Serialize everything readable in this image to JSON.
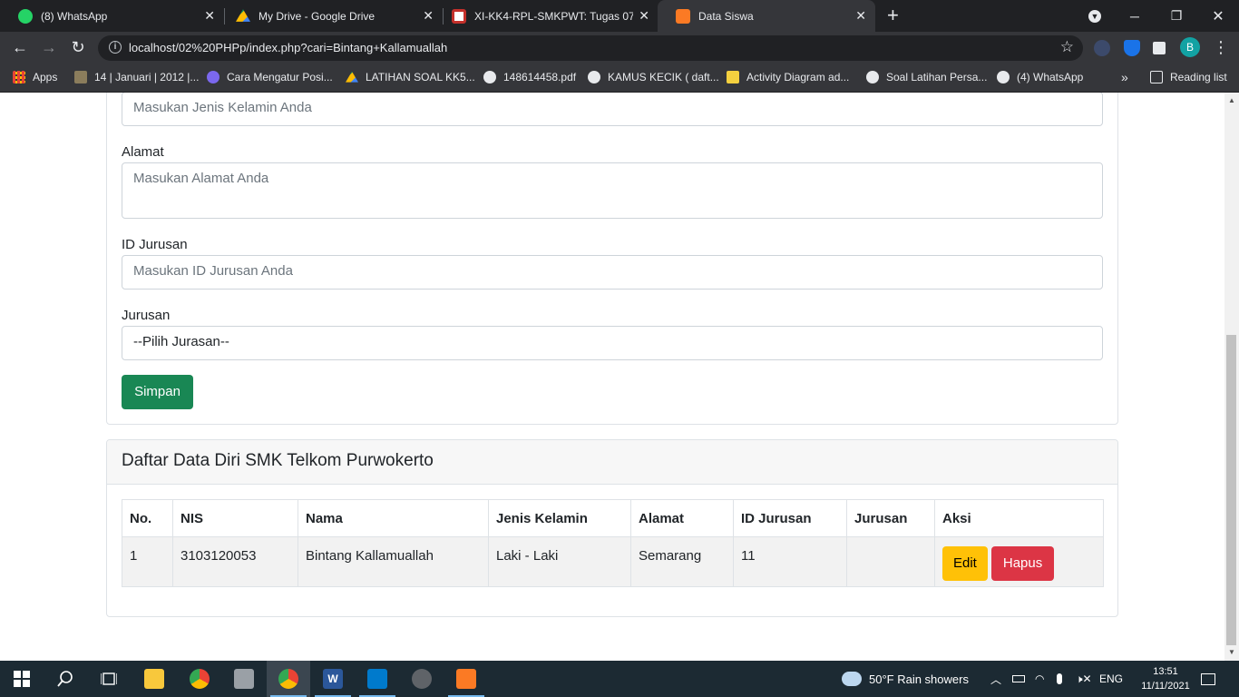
{
  "tabs": [
    {
      "title": "(8) WhatsApp",
      "favicon": "whatsapp-icon",
      "color": "#25d366"
    },
    {
      "title": "My Drive - Google Drive",
      "favicon": "google-drive-icon",
      "color": "#fbbc04"
    },
    {
      "title": "XI-KK4-RPL-SMKPWT: Tugas 07 :",
      "favicon": "moodle-icon",
      "color": "#c4302b"
    },
    {
      "title": "Data Siswa",
      "favicon": "xampp-icon",
      "color": "#fb7a24"
    }
  ],
  "address_bar": {
    "url": "localhost/02%20PHPp/index.php?cari=Bintang+Kallamuallah"
  },
  "profile_initial": "B",
  "bookmarks": [
    {
      "label": "Apps",
      "icon": "apps-grid-icon"
    },
    {
      "label": "14 | Januari | 2012 |...",
      "icon": "bookmark-image-icon"
    },
    {
      "label": "Cara Mengatur Posi...",
      "icon": "bookmark-site-icon"
    },
    {
      "label": "LATIHAN SOAL KK5...",
      "icon": "google-drive-icon"
    },
    {
      "label": "148614458.pdf",
      "icon": "globe-icon"
    },
    {
      "label": "KAMUS KECIK ( daft...",
      "icon": "wordpress-icon"
    },
    {
      "label": "Activity Diagram ad...",
      "icon": "bookmark-site-icon"
    },
    {
      "label": "Soal Latihan Persa...",
      "icon": "globe-icon"
    },
    {
      "label": "(4) WhatsApp",
      "icon": "globe-icon"
    }
  ],
  "reading_list": "Reading list",
  "form": {
    "jenis_kelamin_placeholder": "Masukan Jenis Kelamin Anda",
    "alamat_label": "Alamat",
    "alamat_placeholder": "Masukan Alamat Anda",
    "id_jurusan_label": "ID Jurusan",
    "id_jurusan_placeholder": "Masukan ID Jurusan Anda",
    "jurusan_label": "Jurusan",
    "jurusan_selected": "--Pilih Jurasan--",
    "submit_label": "Simpan"
  },
  "list": {
    "title": "Daftar Data Diri SMK Telkom Purwokerto",
    "headers": [
      "No.",
      "NIS",
      "Nama",
      "Jenis Kelamin",
      "Alamat",
      "ID Jurusan",
      "Jurusan",
      "Aksi"
    ],
    "rows": [
      {
        "no": "1",
        "nis": "3103120053",
        "nama": "Bintang Kallamuallah",
        "jenis_kelamin": "Laki - Laki",
        "alamat": "Semarang",
        "id_jurusan": "11",
        "jurusan": "",
        "edit": "Edit",
        "hapus": "Hapus"
      }
    ]
  },
  "taskbar": {
    "weather": "50°F  Rain showers",
    "language": "ENG",
    "time": "13:51",
    "date": "11/11/2021"
  }
}
